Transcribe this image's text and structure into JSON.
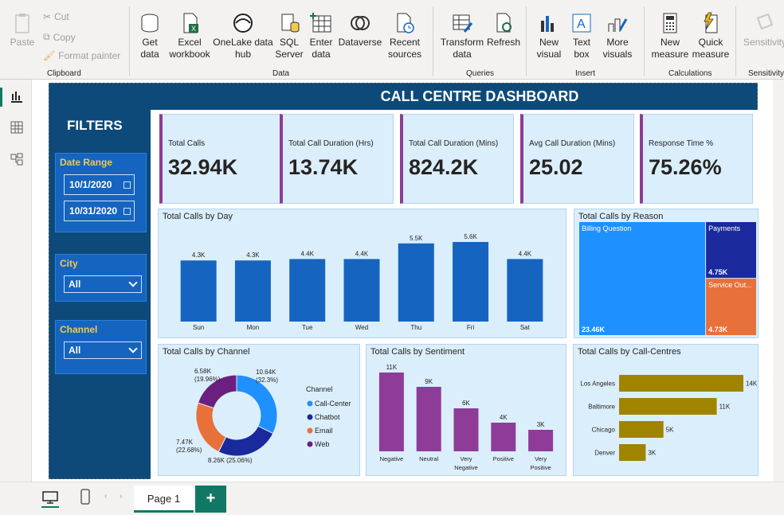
{
  "ribbon": {
    "clipboard": {
      "paste": "Paste",
      "cut": "Cut",
      "copy": "Copy",
      "format_painter": "Format painter",
      "label": "Clipboard"
    },
    "data": {
      "get_data": [
        "Get",
        "data"
      ],
      "excel": [
        "Excel",
        "workbook"
      ],
      "onelake": [
        "OneLake data",
        "hub"
      ],
      "sql": [
        "SQL",
        "Server"
      ],
      "enter": [
        "Enter",
        "data"
      ],
      "dataverse": "Dataverse",
      "recent": [
        "Recent",
        "sources"
      ],
      "label": "Data"
    },
    "queries": {
      "transform": [
        "Transform",
        "data"
      ],
      "refresh": "Refresh",
      "label": "Queries"
    },
    "insert": {
      "new_visual": [
        "New",
        "visual"
      ],
      "text_box": [
        "Text",
        "box"
      ],
      "more_visuals": [
        "More",
        "visuals"
      ],
      "label": "Insert"
    },
    "calculations": {
      "new_measure": [
        "New",
        "measure"
      ],
      "quick_measure": [
        "Quick",
        "measure"
      ],
      "label": "Calculations"
    },
    "sensitivity": {
      "sensitivity": "Sensitivity",
      "label": "Sensitivity"
    }
  },
  "dashboard": {
    "title": "CALL CENTRE DASHBOARD",
    "filters_title": "FILTERS",
    "date_range": {
      "label": "Date Range",
      "start": "10/1/2020",
      "end": "10/31/2020"
    },
    "city": {
      "label": "City",
      "value": "All"
    },
    "channel": {
      "label": "Channel",
      "value": "All"
    },
    "kpis": [
      {
        "label": "Total Calls",
        "value": "32.94K"
      },
      {
        "label": "Total Call Duration (Hrs)",
        "value": "13.74K"
      },
      {
        "label": "Total Call Duration (Mins)",
        "value": "824.2K"
      },
      {
        "label": "Avg Call Duration (Mins)",
        "value": "25.02"
      },
      {
        "label": "Response Time %",
        "value": "75.26%"
      }
    ]
  },
  "chart_data": [
    {
      "type": "bar",
      "title": "Total Calls by Day",
      "categories": [
        "Sun",
        "Mon",
        "Tue",
        "Wed",
        "Thu",
        "Fri",
        "Sat"
      ],
      "values": [
        4300,
        4300,
        4400,
        4400,
        5500,
        5600,
        4400
      ],
      "data_labels": [
        "4.3K",
        "4.3K",
        "4.4K",
        "4.4K",
        "5.5K",
        "5.6K",
        "4.4K"
      ],
      "color": "#1565c0"
    },
    {
      "type": "heatmap",
      "title": "Total Calls by Reason",
      "categories": [
        "Billing Question",
        "Payments",
        "Service Out..."
      ],
      "values": [
        23460,
        4750,
        4730
      ],
      "data_labels": [
        "23.46K",
        "4.75K",
        "4.73K"
      ],
      "colors": [
        "#1e90ff",
        "#1a2a9c",
        "#e8703a"
      ]
    },
    {
      "type": "pie",
      "title": "Total Calls by Channel",
      "legend_title": "Channel",
      "categories": [
        "Call-Center",
        "Chatbot",
        "Email",
        "Web"
      ],
      "values": [
        10640,
        8260,
        7470,
        6580
      ],
      "data_labels": [
        "10.64K\n(32.3%)",
        "8.26K (25.06%)",
        "7.47K\n(22.68%)",
        "6.58K\n(19.96%)"
      ],
      "colors": [
        "#1e90ff",
        "#1a2a9c",
        "#e8703a",
        "#6b1f7f"
      ]
    },
    {
      "type": "bar",
      "title": "Total Calls by Sentiment",
      "categories": [
        "Negative",
        "Neutral",
        "Very Negative",
        "Positive",
        "Very Positive"
      ],
      "values": [
        11000,
        9000,
        6000,
        4000,
        3000
      ],
      "data_labels": [
        "11K",
        "9K",
        "6K",
        "4K",
        "3K"
      ],
      "color": "#8e3c97"
    },
    {
      "type": "bar",
      "orientation": "horizontal",
      "title": "Total Calls by Call-Centres",
      "categories": [
        "Los Angeles",
        "Baltimore",
        "Chicago",
        "Denver"
      ],
      "values": [
        14000,
        11000,
        5000,
        3000
      ],
      "data_labels": [
        "14K",
        "11K",
        "5K",
        "3K"
      ],
      "color": "#a08400"
    }
  ],
  "pages": {
    "current": "Page 1",
    "add": "+"
  }
}
